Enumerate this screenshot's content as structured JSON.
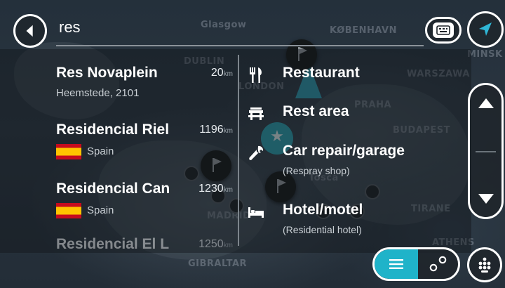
{
  "search": {
    "query": "res"
  },
  "map": {
    "city_labels": [
      "Glasgow",
      "KØBENHAVN",
      "DUBLIN",
      "LONDON",
      "WARSZAWA",
      "PRAHA",
      "BUDAPEST",
      "MADRID",
      "GIBRALTAR",
      "ATHENS",
      "Tosca",
      "TIRANE",
      "MINSK"
    ]
  },
  "results": [
    {
      "name": "Res Novaplein",
      "distance": "20",
      "unit": "km",
      "subtitle": "Heemstede, 2101",
      "flag": ""
    },
    {
      "name": "Residencial Riel",
      "distance": "1196",
      "unit": "km",
      "subtitle": "Spain",
      "flag": "es"
    },
    {
      "name": "Residencial Can",
      "distance": "1230",
      "unit": "km",
      "subtitle": "Spain",
      "flag": "es"
    },
    {
      "name": "Residencial El L",
      "distance": "1250",
      "unit": "km",
      "subtitle": "",
      "flag": ""
    }
  ],
  "categories": [
    {
      "label": "Restaurant",
      "subtitle": "",
      "icon": "fork-knife-icon"
    },
    {
      "label": "Rest area",
      "subtitle": "",
      "icon": "rest-area-icon"
    },
    {
      "label": "Car repair/garage",
      "subtitle": "(Respray shop)",
      "icon": "wrench-icon"
    },
    {
      "label": "Hotel/motel",
      "subtitle": "(Residential hotel)",
      "icon": "bed-icon"
    }
  ],
  "colors": {
    "accent": "#1fb3c9",
    "nav_arrow": "#1fb3c9",
    "flag_red": "#c60b1e",
    "flag_yellow": "#ffc400"
  },
  "icons": {
    "back": "back-arrow-icon",
    "keyboard_language": "keyboard-language-icon",
    "current_location": "navigation-arrow-icon",
    "scroll_up": "chevron-up-icon",
    "scroll_down": "chevron-down-icon",
    "list_view": "list-icon",
    "map_view": "route-points-icon",
    "keyboard": "keypad-icon"
  },
  "view_toggle": {
    "active": "list"
  }
}
